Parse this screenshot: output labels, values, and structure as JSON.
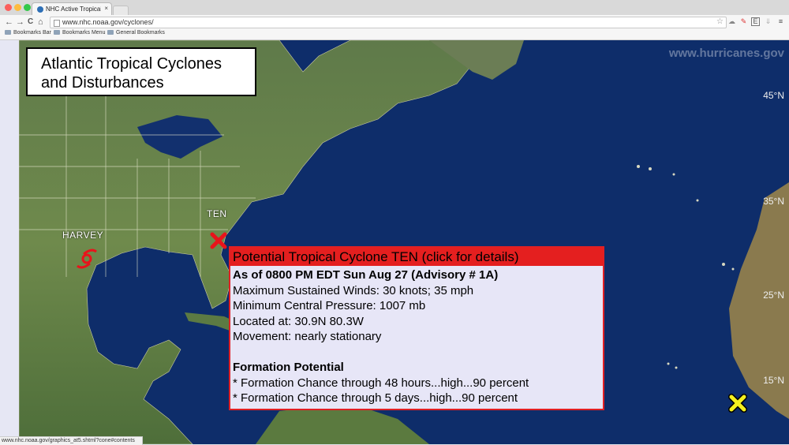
{
  "browser": {
    "tab": {
      "title": "NHC Active Tropical Cyclones",
      "close": "×"
    },
    "url": "www.nhc.noaa.gov/cyclones/",
    "nav": {
      "back": "←",
      "forward": "→",
      "reload": "C",
      "home": "⌂"
    },
    "bookmarks": [
      "Bookmarks Bar",
      "Bookmarks Menu",
      "General Bookmarks"
    ],
    "status_url": "www.nhc.noaa.gov/graphics_at5.shtml?cone#contents"
  },
  "map": {
    "title_line1": "Atlantic Tropical Cyclones",
    "title_line2": "and Disturbances",
    "watermark": "www.hurricanes.gov",
    "latitudes": [
      "45°N",
      "35°N",
      "25°N",
      "15°N"
    ],
    "storms": {
      "harvey": "HARVEY",
      "ten": "TEN"
    },
    "colors": {
      "ocean": "#0e2d6a",
      "popup_header": "#e41f1f",
      "popup_bg": "#e7e6f7",
      "marker_red": "#e8141b",
      "marker_yellow": "#f4f01e"
    }
  },
  "popup": {
    "title": "Potential Tropical Cyclone TEN (click for details)",
    "advisory": "As of 0800 PM EDT Sun Aug 27 (Advisory # 1A)",
    "winds": "Maximum Sustained Winds: 30 knots; 35 mph",
    "pressure": "Minimum Central Pressure: 1007 mb",
    "location": "Located at: 30.9N 80.3W",
    "movement": "Movement: nearly stationary",
    "formation_heading": "Formation Potential",
    "formation_48h": "* Formation Chance through 48 hours...high...90 percent",
    "formation_5d": "* Formation Chance through 5 days...high...90 percent"
  }
}
